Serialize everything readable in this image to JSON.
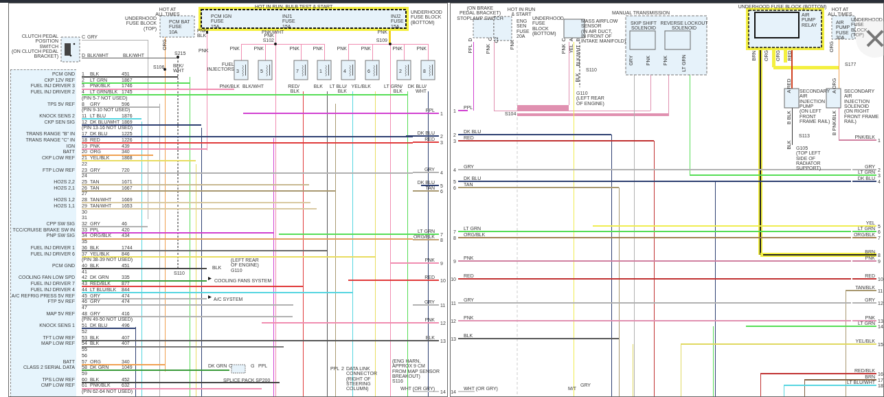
{
  "left_sheet": {
    "labels": [
      "HOT AT\nALL TIMES",
      "UNDERHOOD\nFUSE BLOCK\n(TOP)",
      "PCM BAT\nFUSE\n10A",
      "ORG",
      "CLUTCH PEDAL\nPOSITION\nSWITCH\n(ON CLUTCH PEDAL\nBRACKET)",
      "C",
      "GRY",
      "D",
      "BLK/WHT",
      "BLK/WHT",
      "S215",
      "S106",
      "BLK/\nWHT",
      "HOT IN RUN, BULB TEST & START",
      "PCM IGN\nFUSE\n15A",
      "INJ1\nFUSE\n15A",
      "INJ2\nFUSE\n15A",
      "UNDERHOOD\nFUSE BLOCK\n(BOTTOM)",
      "PNK/\nBLK",
      "PNK",
      "PNK/WHT",
      "PNK",
      "S102",
      "PNK",
      "S109",
      "FUEL\nINJECTORS",
      "(LEFT REAR\nOF ENGINE)",
      "BLK",
      "G110",
      "S110",
      "COOLING FANS SYSTEM",
      "A/C SYSTEM",
      "DK GRN",
      "C",
      "G",
      "PPL",
      "SPLICE PACK SP200",
      "PPL",
      "2",
      "DATA LINK\nCONNECTOR\n(RIGHT OF\nSTEERING\nCOLUMN)",
      "(ENG HARN,\nAPPROX 9 CM\nFROM MAP SENSOR\nBREAKOUT)\nS116"
    ],
    "fuel_injectors": [
      {
        "number": "3",
        "supply": "PNK",
        "ground": "PNK/BLK"
      },
      {
        "number": "5",
        "supply": "PNK",
        "ground": "BLK/WHT"
      },
      {
        "number": "7",
        "supply": "PNK",
        "ground": "RED/\nBLK"
      },
      {
        "number": "1",
        "supply": "PNK",
        "ground": "BLK"
      },
      {
        "number": "4",
        "supply": "PNK",
        "ground": "LT BLU/\nBLK"
      },
      {
        "number": "6",
        "supply": "PNK",
        "ground": "YEL/BLK"
      },
      {
        "number": "2",
        "supply": "PNK",
        "ground": "LT GRN/\nBLK"
      },
      {
        "number": "8",
        "supply": "PNK",
        "ground": "DK BLU/\nWHT"
      }
    ],
    "pcm_connector": {
      "rows": [
        {
          "kind": "pin",
          "pin": "1",
          "wire": "BLK",
          "circuit": "451",
          "label": "PCM GND",
          "color": "#444444"
        },
        {
          "kind": "pin",
          "pin": "2",
          "wire": "LT GRN",
          "circuit": "1867",
          "label": "CKP 12V REF",
          "color": "#55dd55"
        },
        {
          "kind": "pin",
          "pin": "3",
          "wire": "PNK/BLK",
          "circuit": "1746",
          "label": "FUEL INJ DRIVER 3",
          "color": "#f08cb0"
        },
        {
          "kind": "pin",
          "pin": "4",
          "wire": "LT GRN/BLK",
          "circuit": "1745",
          "label": "FUEL INJ DRIVER 2",
          "color": "#55dd55"
        },
        {
          "kind": "note",
          "text": "(PIN 5-7 NOT USED)"
        },
        {
          "kind": "pin",
          "pin": "8",
          "wire": "GRY",
          "circuit": "596",
          "label": "TPS 5V REF",
          "color": "#b0b0b0"
        },
        {
          "kind": "note",
          "text": "(PIN 9-10 NOT USED)"
        },
        {
          "kind": "pin",
          "pin": "11",
          "wire": "LT BLU",
          "circuit": "1876",
          "label": "KNOCK SENS 2",
          "color": "#55d5e0"
        },
        {
          "kind": "pin",
          "pin": "12",
          "wire": "DK BLU/WHT",
          "circuit": "1869",
          "label": "CKP SEN SIG",
          "color": "#2c3e70"
        },
        {
          "kind": "note",
          "text": "(PIN 13-16 NOT USED)"
        },
        {
          "kind": "pin",
          "pin": "17",
          "wire": "DK BLU",
          "circuit": "1225",
          "label": "TRANS RANGE \"B\" IN",
          "color": "#2c3e70"
        },
        {
          "kind": "pin",
          "pin": "18",
          "wire": "RED",
          "circuit": "1226",
          "label": "TRANS RANGE \"C\" IN",
          "color": "#e03a3a"
        },
        {
          "kind": "pin",
          "pin": "19",
          "wire": "PNK",
          "circuit": "439",
          "label": "IGN",
          "color": "#f08cb0"
        },
        {
          "kind": "pin",
          "pin": "20",
          "wire": "ORG",
          "circuit": "340",
          "label": "BATT",
          "color": "#f0a050"
        },
        {
          "kind": "pin",
          "pin": "21",
          "wire": "YEL/BLK",
          "circuit": "1868",
          "label": "CKP LOW REF",
          "color": "#e8dc60"
        },
        {
          "kind": "pin",
          "pin": "22"
        },
        {
          "kind": "pin",
          "pin": "23",
          "wire": "GRY",
          "circuit": "720",
          "label": "FTP LOW REF",
          "color": "#b0b0b0"
        },
        {
          "kind": "pin",
          "pin": "24"
        },
        {
          "kind": "pin",
          "pin": "25",
          "wire": "TAN",
          "circuit": "1671",
          "label": "HO2S 2,2",
          "color": "#c8b890"
        },
        {
          "kind": "pin",
          "pin": "26",
          "wire": "TAN",
          "circuit": "1667",
          "label": "HO2S 2,1",
          "color": "#a89870"
        },
        {
          "kind": "pin",
          "pin": "27"
        },
        {
          "kind": "pin",
          "pin": "28",
          "wire": "TAN/WHT",
          "circuit": "1669",
          "label": "HO2S 1,2",
          "color": "#d8c8a0"
        },
        {
          "kind": "pin",
          "pin": "29",
          "wire": "TAN/WHT",
          "circuit": "1653",
          "label": "HO2S 1,1",
          "color": "#d8c8a0"
        },
        {
          "kind": "pin",
          "pin": "30"
        },
        {
          "kind": "pin",
          "pin": "31"
        },
        {
          "kind": "pin",
          "pin": "32",
          "wire": "GRY",
          "circuit": "46",
          "label": "CPP SW SIG",
          "color": "#b0b0b0"
        },
        {
          "kind": "pin",
          "pin": "33",
          "wire": "PPL",
          "circuit": "420",
          "label": "TCC/CRUISE BRAKE SW IN",
          "color": "#d040d0"
        },
        {
          "kind": "pin",
          "pin": "34",
          "wire": "ORG/BLK",
          "circuit": "434",
          "label": "PNP SW SIG",
          "color": "#e0a060"
        },
        {
          "kind": "pin",
          "pin": "35"
        },
        {
          "kind": "pin",
          "pin": "36",
          "wire": "BLK",
          "circuit": "1744",
          "label": "FUEL INJ DRIVER 1",
          "color": "#666666"
        },
        {
          "kind": "pin",
          "pin": "37",
          "wire": "YEL/BLK",
          "circuit": "846",
          "label": "FUEL INJ DRIVER 6",
          "color": "#e8dc60"
        },
        {
          "kind": "note",
          "text": "(PIN 38-39 NOT USED)"
        },
        {
          "kind": "pin",
          "pin": "40",
          "wire": "BLK",
          "circuit": "451",
          "label": "PCM GND",
          "color": "#444444"
        },
        {
          "kind": "pin",
          "pin": "41"
        },
        {
          "kind": "pin",
          "pin": "42",
          "wire": "DK GRN",
          "circuit": "335",
          "label": "COOLING FAN LOW SPD",
          "color": "#3a9a3a"
        },
        {
          "kind": "pin",
          "pin": "43",
          "wire": "RED/BLK",
          "circuit": "877",
          "label": "FUEL INJ DRIVER 7",
          "color": "#e03a3a"
        },
        {
          "kind": "pin",
          "pin": "44",
          "wire": "LT BLU/BLK",
          "circuit": "844",
          "label": "FUEL INJ DRIVER 4",
          "color": "#55d5e0"
        },
        {
          "kind": "pin",
          "pin": "45",
          "wire": "GRY",
          "circuit": "474",
          "label": "A/C REFRIG PRESS 5V REF",
          "color": "#b0b0b0"
        },
        {
          "kind": "pin",
          "pin": "46",
          "wire": "GRY",
          "circuit": "474",
          "label": "FTP 5V REF",
          "color": "#b0b0b0"
        },
        {
          "kind": "pin",
          "pin": "47"
        },
        {
          "kind": "pin",
          "pin": "48",
          "wire": "GRY",
          "circuit": "416",
          "label": "MAP 5V REF",
          "color": "#b0b0b0"
        },
        {
          "kind": "note",
          "text": "(PIN 49-50 NOT USED)"
        },
        {
          "kind": "pin",
          "pin": "51",
          "wire": "DK BLU",
          "circuit": "496",
          "label": "KNOCK SENS 1",
          "color": "#2c3e70"
        },
        {
          "kind": "pin",
          "pin": "52"
        },
        {
          "kind": "pin",
          "pin": "53",
          "wire": "BLK",
          "circuit": "407",
          "label": "TFT LOW REF",
          "color": "#555555"
        },
        {
          "kind": "pin",
          "pin": "54",
          "wire": "BLK",
          "circuit": "407",
          "label": "MAP LOW REF",
          "color": "#777777"
        },
        {
          "kind": "pin",
          "pin": "55"
        },
        {
          "kind": "pin",
          "pin": "56"
        },
        {
          "kind": "pin",
          "pin": "57",
          "wire": "ORG",
          "circuit": "340",
          "label": "BATT",
          "color": "#f0a050"
        },
        {
          "kind": "pin",
          "pin": "58",
          "wire": "DK GRN",
          "circuit": "1049",
          "label": "CLASS 2 SERIAL DATA",
          "color": "#3a9a3a"
        },
        {
          "kind": "pin",
          "pin": "59"
        },
        {
          "kind": "pin",
          "pin": "60",
          "wire": "BLK",
          "circuit": "452",
          "label": "TPS LOW REF",
          "color": "#444444"
        },
        {
          "kind": "pin",
          "pin": "61",
          "wire": "PNK/BLK",
          "circuit": "632",
          "label": "CMP LOW REF",
          "color": "#f08cb0"
        },
        {
          "kind": "note",
          "text": "(PIN 62-64 NOT USED)"
        }
      ]
    },
    "wire_ends": [
      {
        "number": "1",
        "wire": "PPL",
        "color": "#d040d0"
      },
      {
        "number": "2",
        "wire": "DK BLU",
        "color": "#2c3e70"
      },
      {
        "number": "3",
        "wire": "RED",
        "color": "#e03a3a"
      },
      {
        "number": "4",
        "wire": "GRY",
        "color": "#b0b0b0"
      },
      {
        "number": "5",
        "wire": "DK BLU",
        "color": "#2c3e70"
      },
      {
        "number": "6",
        "wire": "TAN",
        "color": "#a89870"
      },
      {
        "number": "7",
        "wire": "LT GRN",
        "color": "#55dd55"
      },
      {
        "number": "8",
        "wire": "ORG/BLK",
        "color": "#c0a070"
      },
      {
        "number": "9",
        "wire": "PNK",
        "color": "#f08cb0"
      },
      {
        "number": "10",
        "wire": "RED",
        "color": "#e03a3a"
      },
      {
        "number": "11",
        "wire": "GRY",
        "color": "#b0b0b0"
      },
      {
        "number": "12",
        "wire": "PNK",
        "color": "#f08cb0"
      },
      {
        "number": "13",
        "wire": "BLK",
        "color": "#555555"
      },
      {
        "number": "14",
        "wire": "WHT (OR GRY)",
        "color": "#cccccc"
      }
    ]
  },
  "right_sheet": {
    "labels": [
      "(ON BRAKE\nPEDAL BRACKET)\nSTOPLAMP SWITCH",
      "D",
      "C",
      "C2",
      "PPL",
      "PNK",
      "HOT IN RUN\n& START",
      "ENG\nSEN\nFUSE\n20A",
      "UNDERHOOD\nFUSE\nBLOCK\n(BOTTOM)",
      "PNK",
      "MASS AIRFLOW\nSENSOR\n(IN AIR DUCT,\nIN FRONT OF\nINTAKE MANIFOLD)",
      "C",
      "A",
      "B",
      "PNK",
      "YEL",
      "BLK/WHT",
      "S110",
      "BLK",
      "G110\n(LEFT REAR\nOF ENGINE)",
      "S104",
      "MANUAL TRANSMISSION",
      "SKIP SHIFT\nSOLENOID",
      "REVERSE LOCKOUT\nSOLENOID",
      "GRY",
      "PNK",
      "PNK",
      "LT GRN",
      "UNDERHOOD FUSE BLOCK (BOTTOM)",
      "AIR\nPUMP\nRELAY",
      "BRN",
      "ORG",
      "ORG",
      "RED",
      "HOT AT\nALL TIMES",
      "AIR\nPUMP\nFUSE\n30A",
      "UNDERHOOD\nFUSE\nBLOCK\n(TOP)",
      "ORG",
      "S177",
      "A RED",
      "A ORG",
      "SECONDARY\nAIR\nINJECTION\nPUMP\n(ON LEFT\nFRONT\nFRAME RAIL)",
      "SECONDARY\nAIR\nINJECTION\nSOLENOID\n(ON RIGHT\nFRONT FRAME\nRAIL)",
      "B BLK",
      "B PNK/BLK",
      "S113",
      "BLK",
      "G105\n(TOP LEFT\nSIDE OF\nRADIATOR\nSUPPORT)",
      "M/T",
      "GRY"
    ],
    "left_wire_ends": [
      {
        "number": "1",
        "wire": "PPL",
        "color": "#d040d0"
      },
      {
        "number": "2",
        "wire": "DK BLU",
        "color": "#2c3e70"
      },
      {
        "number": "3",
        "wire": "RED",
        "color": "#c03030"
      },
      {
        "number": "4",
        "wire": "GRY",
        "color": "#b0b0b0"
      },
      {
        "number": "5",
        "wire": "DK BLU",
        "color": "#2c3e70"
      },
      {
        "number": "6",
        "wire": "TAN",
        "color": "#a89870"
      },
      {
        "number": "7",
        "wire": "LT GRN",
        "color": "#55dd55"
      },
      {
        "number": "8",
        "wire": "ORG/BLK",
        "color": "#a08050"
      },
      {
        "number": "9",
        "wire": "PNK",
        "color": "#d080a0"
      },
      {
        "number": "10",
        "wire": "RED",
        "color": "#c03030"
      },
      {
        "number": "11",
        "wire": "GRY",
        "color": "#b0b0b0"
      },
      {
        "number": "12",
        "wire": "PNK",
        "color": "#e090b0"
      },
      {
        "number": "13",
        "wire": "BLK",
        "color": "#555555"
      },
      {
        "number": "14",
        "wire": "WHT (OR GRY)",
        "color": "#cccccc"
      }
    ],
    "right_wire_ends": [
      {
        "number": "1",
        "wire": "PNK/BLK",
        "color": "#d080a0"
      },
      {
        "number": "2",
        "wire": "GRY",
        "color": "#b0b0b0"
      },
      {
        "number": "3",
        "wire": "LT GRN",
        "color": "#55dd55"
      },
      {
        "number": "4",
        "wire": "DK BLU",
        "color": "#2c3e70"
      },
      {
        "number": "5",
        "wire": "YEL",
        "color": "#f0ec50"
      },
      {
        "number": "6",
        "wire": "LT GRN",
        "color": "#55dd55"
      },
      {
        "number": "7",
        "wire": "ORG/BLK",
        "color": "#a08050"
      },
      {
        "number": "8",
        "wire": "BRN",
        "color": "#222222"
      },
      {
        "number": "9",
        "wire": "PNK",
        "color": "#d080a0"
      },
      {
        "number": "10",
        "wire": "RED",
        "color": "#c03030"
      },
      {
        "number": "11",
        "wire": "TAN/BLK",
        "color": "#a89870"
      },
      {
        "number": "12",
        "wire": "GRY",
        "color": "#b0b0b0"
      },
      {
        "number": "13",
        "wire": "PNK",
        "color": "#e090b0"
      },
      {
        "number": "14",
        "wire": "LT GRN",
        "color": "#55dd55"
      },
      {
        "number": "15",
        "wire": "YEL/BLK",
        "color": "#e0d860"
      },
      {
        "number": "16",
        "wire": "RED/BLK",
        "color": "#c03030"
      },
      {
        "number": "17",
        "wire": "BRN",
        "color": "#806040"
      },
      {
        "number": "18",
        "wire": "LT BLU/WHT",
        "color": "#55d5e0"
      }
    ]
  }
}
